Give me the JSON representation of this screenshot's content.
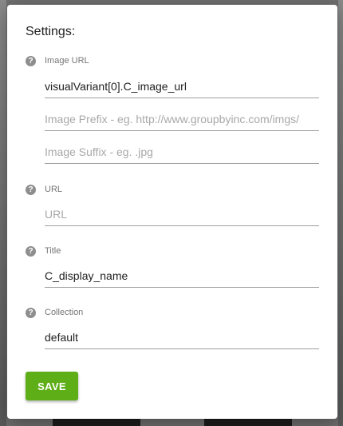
{
  "dialog": {
    "title": "Settings:"
  },
  "sections": {
    "image_url": {
      "label": "Image URL",
      "icon": "help-icon",
      "fields": {
        "url": {
          "value": "visualVariant[0].C_image_url",
          "placeholder": ""
        },
        "prefix": {
          "value": "",
          "placeholder": "Image Prefix - eg. http://www.groupbyinc.com/imgs/"
        },
        "suffix": {
          "value": "",
          "placeholder": "Image Suffix - eg. .jpg"
        }
      }
    },
    "url": {
      "label": "URL",
      "icon": "help-icon",
      "field": {
        "value": "",
        "placeholder": "URL"
      }
    },
    "title": {
      "label": "Title",
      "icon": "help-icon",
      "field": {
        "value": "C_display_name",
        "placeholder": ""
      }
    },
    "collection": {
      "label": "Collection",
      "icon": "help-icon",
      "field": {
        "value": "default",
        "placeholder": ""
      }
    }
  },
  "help_glyph": "?",
  "actions": {
    "save_label": "SAVE"
  },
  "colors": {
    "primary": "#5dae17",
    "backdrop": "#6f6f6f",
    "help_icon": "#8e8e8e"
  }
}
